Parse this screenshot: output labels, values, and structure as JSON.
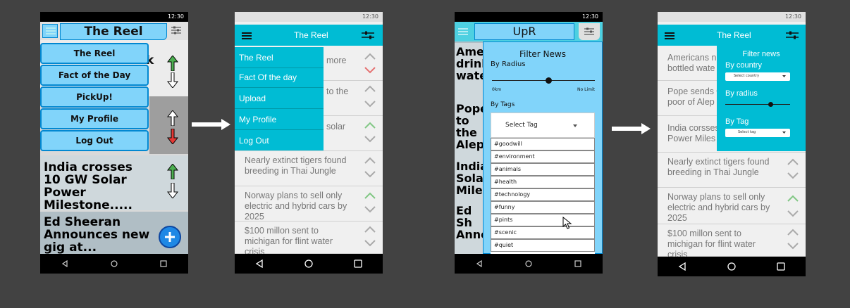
{
  "status": {
    "time": "12:30"
  },
  "screen1": {
    "title": "The Reel",
    "menu": [
      "The Reel",
      "Fact of the Day",
      "PickUp!",
      "My Profile",
      "Log Out"
    ],
    "partial_text": "k",
    "news": [
      "India crosses 10 GW Solar Power Milestone.....",
      "Ed Sheeran Announces new gig at..."
    ]
  },
  "screen2": {
    "title": "The Reel",
    "menu": [
      "The Reel",
      "Fact Of the day",
      "Upload",
      "My Profile",
      "Log Out"
    ],
    "partial": [
      "more",
      "to the",
      "solar"
    ],
    "news": [
      "Nearly extinct tigers found breeding in Thai Jungle",
      "Norway plans to sell only electric and hybrid cars by 2025",
      "$100 millon sent to michigan for flint water crisis"
    ]
  },
  "screen3": {
    "title": "UpR",
    "bg_words": [
      "Amer",
      "drink",
      "wate",
      "Pope",
      "to the",
      "Alepp",
      "India",
      "Solar",
      "Miles",
      "Ed Sh",
      "Anno"
    ],
    "filter": {
      "title": "Filter News",
      "by_radius": "By Radius",
      "min": "0km",
      "max": "No Limit",
      "slider_value": 0.55,
      "by_tags": "By Tags",
      "select_tag": "Select Tag",
      "tags": [
        "#goodwill",
        "#environment",
        "#animals",
        "#health",
        "#technology",
        "#funny",
        "#pints",
        "#scenic",
        "#quiet"
      ]
    }
  },
  "screen4": {
    "title": "The Reel",
    "partial": [
      "Americans ne bottled wate",
      "Pope sends € poor of Alep",
      "India corsses Power Miles"
    ],
    "news": [
      "Nearly extinct tigers found breeding in Thai Jungle",
      "Norway plans to sell only electric and hybrid cars by 2025",
      "$100 millon sent to michigan for flint water crisis"
    ],
    "filter": {
      "title": "Filter news",
      "by_country": "By country",
      "select_country": "Select country",
      "by_radius": "By radius",
      "slider_value": 0.7,
      "by_tag": "By Tag",
      "select_tag": "Select tag"
    }
  },
  "colors": {
    "teal": "#00bcd4",
    "light_blue": "#81d4fa",
    "green_arrow": "#4caf50",
    "red_arrow": "#e53935"
  }
}
